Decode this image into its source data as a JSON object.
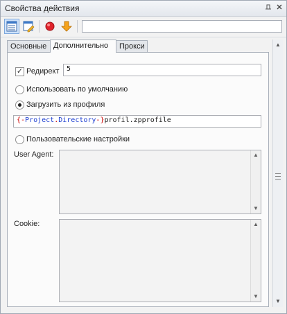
{
  "window": {
    "title": "Свойства действия"
  },
  "toolbar": {
    "search_value": ""
  },
  "tabs": [
    {
      "label": "Основные"
    },
    {
      "label": "Дополнительно"
    },
    {
      "label": "Прокси"
    }
  ],
  "form": {
    "redirect": {
      "label": "Редирект",
      "checked": true,
      "value": "5"
    },
    "radio_default": {
      "label": "Использовать по умолчанию",
      "selected": false
    },
    "radio_profile": {
      "label": "Загрузить из профиля",
      "selected": true
    },
    "profile_path": {
      "open": "{-",
      "project": "Project",
      "dot": ".",
      "directory": "Directory",
      "close": "-}",
      "file": "profil.zpprofile"
    },
    "radio_custom": {
      "label": "Пользовательские настройки",
      "selected": false
    },
    "user_agent": {
      "label": "User Agent:",
      "value": ""
    },
    "cookie": {
      "label": "Cookie:",
      "value": ""
    }
  },
  "colors": {
    "macro_brace": "#cc0000",
    "macro_name": "#1e3fd0",
    "tab_selected_bg": "#fbfbfb",
    "toolbar_active": "#cfe3fb"
  },
  "icons": {
    "tool1": "table-properties-icon",
    "tool2": "edit-properties-icon",
    "tool3": "stop-record-icon",
    "tool4": "arrow-down-icon",
    "title_pin": "pin-icon",
    "title_close": "close-icon"
  }
}
